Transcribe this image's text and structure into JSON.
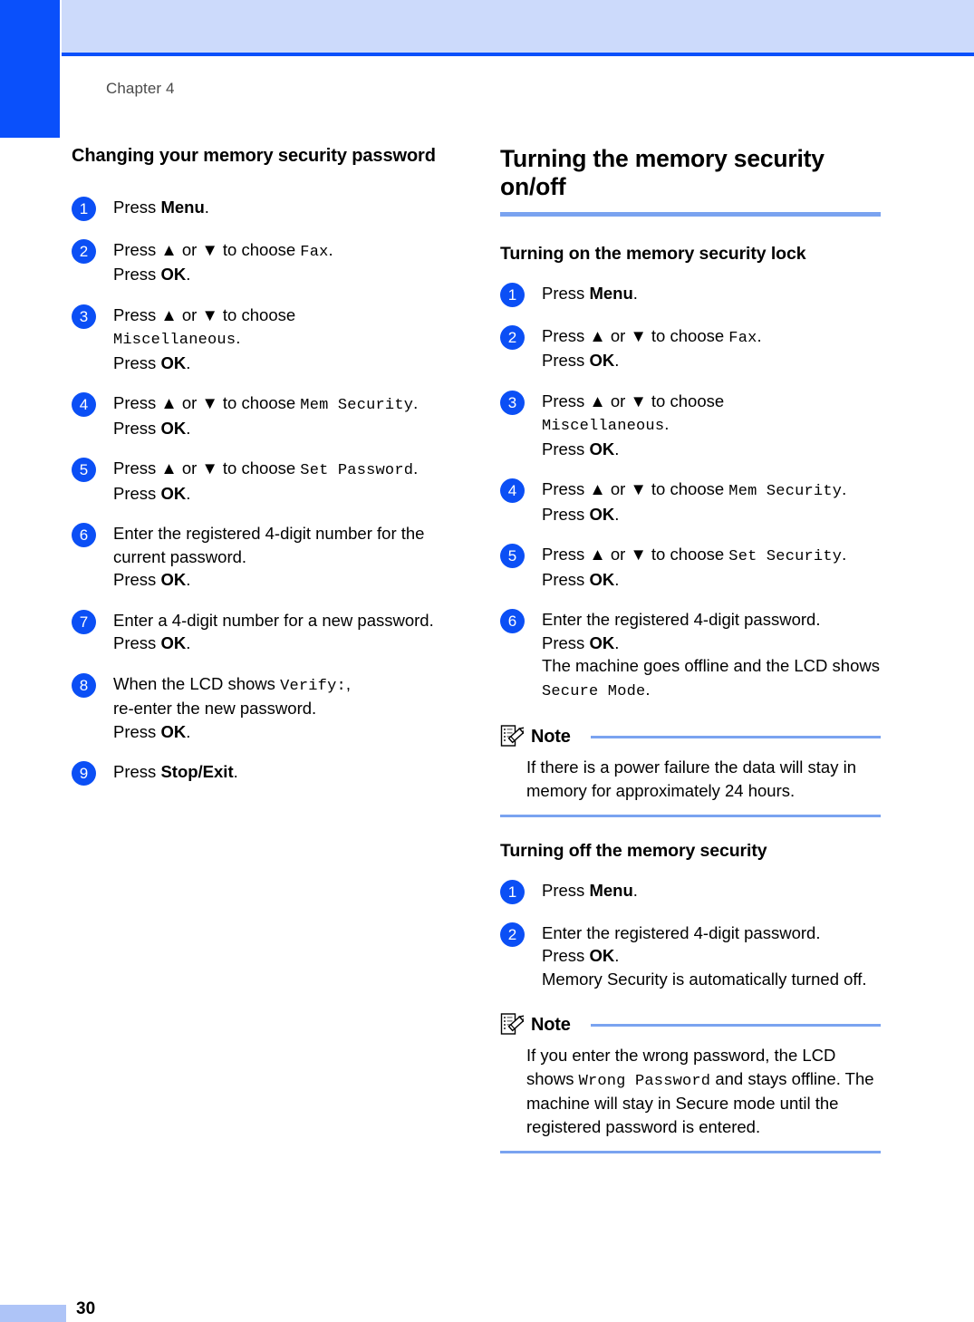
{
  "page": {
    "chapter_label": "Chapter 4",
    "page_number": "30",
    "accent_dark_blue": "#0a50fb",
    "accent_light_blue": "#ccdafb",
    "accent_rule_blue": "#7aa3f0",
    "badge_blue": "#0b4ff5"
  },
  "left_column": {
    "heading": "Changing your memory security password",
    "steps": [
      {
        "number": "1",
        "lines": [
          [
            {
              "t": "Press ",
              "s": "normal"
            },
            {
              "t": "Menu",
              "s": "bold"
            },
            {
              "t": ".",
              "s": "normal"
            }
          ]
        ]
      },
      {
        "number": "2",
        "lines": [
          [
            {
              "t": "Press ▲ or ▼ to choose ",
              "s": "normal"
            },
            {
              "t": "Fax",
              "s": "lcd"
            },
            {
              "t": ".",
              "s": "normal"
            }
          ],
          [
            {
              "t": "Press ",
              "s": "normal"
            },
            {
              "t": "OK",
              "s": "bold"
            },
            {
              "t": ".",
              "s": "normal"
            }
          ]
        ]
      },
      {
        "number": "3",
        "lines": [
          [
            {
              "t": "Press ▲ or ▼ to choose",
              "s": "normal"
            }
          ],
          [
            {
              "t": "Miscellaneous",
              "s": "lcd"
            },
            {
              "t": ".",
              "s": "normal"
            }
          ],
          [
            {
              "t": "Press ",
              "s": "normal"
            },
            {
              "t": "OK",
              "s": "bold"
            },
            {
              "t": ".",
              "s": "normal"
            }
          ]
        ]
      },
      {
        "number": "4",
        "lines": [
          [
            {
              "t": "Press ▲ or ▼ to choose ",
              "s": "normal"
            },
            {
              "t": "Mem Security",
              "s": "lcd"
            },
            {
              "t": ".",
              "s": "normal"
            }
          ],
          [
            {
              "t": "Press ",
              "s": "normal"
            },
            {
              "t": "OK",
              "s": "bold"
            },
            {
              "t": ".",
              "s": "normal"
            }
          ]
        ]
      },
      {
        "number": "5",
        "lines": [
          [
            {
              "t": "Press ▲ or ▼ to choose ",
              "s": "normal"
            },
            {
              "t": "Set Password",
              "s": "lcd"
            },
            {
              "t": ".",
              "s": "normal"
            }
          ],
          [
            {
              "t": "Press ",
              "s": "normal"
            },
            {
              "t": "OK",
              "s": "bold"
            },
            {
              "t": ".",
              "s": "normal"
            }
          ]
        ]
      },
      {
        "number": "6",
        "lines": [
          [
            {
              "t": "Enter the registered 4-digit number for the current password.",
              "s": "normal"
            }
          ],
          [
            {
              "t": "Press ",
              "s": "normal"
            },
            {
              "t": "OK",
              "s": "bold"
            },
            {
              "t": ".",
              "s": "normal"
            }
          ]
        ]
      },
      {
        "number": "7",
        "lines": [
          [
            {
              "t": "Enter a 4-digit number for a new password.",
              "s": "normal"
            }
          ],
          [
            {
              "t": "Press ",
              "s": "normal"
            },
            {
              "t": "OK",
              "s": "bold"
            },
            {
              "t": ".",
              "s": "normal"
            }
          ]
        ]
      },
      {
        "number": "8",
        "lines": [
          [
            {
              "t": "When the LCD shows ",
              "s": "normal"
            },
            {
              "t": "Verify:",
              "s": "lcd"
            },
            {
              "t": ",",
              "s": "normal"
            }
          ],
          [
            {
              "t": "re-enter the new password.",
              "s": "normal"
            }
          ],
          [
            {
              "t": "Press ",
              "s": "normal"
            },
            {
              "t": "OK",
              "s": "bold"
            },
            {
              "t": ".",
              "s": "normal"
            }
          ]
        ]
      },
      {
        "number": "9",
        "lines": [
          [
            {
              "t": "Press ",
              "s": "normal"
            },
            {
              "t": "Stop/Exit",
              "s": "bold"
            },
            {
              "t": ".",
              "s": "normal"
            }
          ]
        ]
      }
    ]
  },
  "right_column": {
    "section_heading": "Turning the memory security on/off",
    "subsection_on": {
      "heading": "Turning on the memory security lock",
      "steps": [
        {
          "number": "1",
          "lines": [
            [
              {
                "t": "Press ",
                "s": "normal"
              },
              {
                "t": "Menu",
                "s": "bold"
              },
              {
                "t": ".",
                "s": "normal"
              }
            ]
          ]
        },
        {
          "number": "2",
          "lines": [
            [
              {
                "t": "Press ▲ or ▼ to choose ",
                "s": "normal"
              },
              {
                "t": "Fax",
                "s": "lcd"
              },
              {
                "t": ".",
                "s": "normal"
              }
            ],
            [
              {
                "t": "Press ",
                "s": "normal"
              },
              {
                "t": "OK",
                "s": "bold"
              },
              {
                "t": ".",
                "s": "normal"
              }
            ]
          ]
        },
        {
          "number": "3",
          "lines": [
            [
              {
                "t": "Press ▲ or ▼ to choose",
                "s": "normal"
              }
            ],
            [
              {
                "t": "Miscellaneous",
                "s": "lcd"
              },
              {
                "t": ".",
                "s": "normal"
              }
            ],
            [
              {
                "t": "Press ",
                "s": "normal"
              },
              {
                "t": "OK",
                "s": "bold"
              },
              {
                "t": ".",
                "s": "normal"
              }
            ]
          ]
        },
        {
          "number": "4",
          "lines": [
            [
              {
                "t": "Press ▲ or ▼ to choose ",
                "s": "normal"
              },
              {
                "t": "Mem Security",
                "s": "lcd"
              },
              {
                "t": ".",
                "s": "normal"
              }
            ],
            [
              {
                "t": "Press ",
                "s": "normal"
              },
              {
                "t": "OK",
                "s": "bold"
              },
              {
                "t": ".",
                "s": "normal"
              }
            ]
          ]
        },
        {
          "number": "5",
          "lines": [
            [
              {
                "t": "Press ▲ or ▼ to choose ",
                "s": "normal"
              },
              {
                "t": "Set Security",
                "s": "lcd"
              },
              {
                "t": ".",
                "s": "normal"
              }
            ],
            [
              {
                "t": "Press ",
                "s": "normal"
              },
              {
                "t": "OK",
                "s": "bold"
              },
              {
                "t": ".",
                "s": "normal"
              }
            ]
          ]
        },
        {
          "number": "6",
          "lines": [
            [
              {
                "t": "Enter the registered 4-digit password.",
                "s": "normal"
              }
            ],
            [
              {
                "t": "Press ",
                "s": "normal"
              },
              {
                "t": "OK",
                "s": "bold"
              },
              {
                "t": ".",
                "s": "normal"
              }
            ],
            [
              {
                "t": "The machine goes offline and the LCD shows ",
                "s": "normal"
              },
              {
                "t": "Secure Mode",
                "s": "lcd"
              },
              {
                "t": ".",
                "s": "normal"
              }
            ]
          ]
        }
      ],
      "note": {
        "label": "Note",
        "icon": "note-pencil-icon",
        "text": "If there is a power failure the data will stay in memory for approximately 24 hours."
      }
    },
    "subsection_off": {
      "heading": "Turning off the memory security",
      "steps": [
        {
          "number": "1",
          "lines": [
            [
              {
                "t": "Press ",
                "s": "normal"
              },
              {
                "t": "Menu",
                "s": "bold"
              },
              {
                "t": ".",
                "s": "normal"
              }
            ]
          ]
        },
        {
          "number": "2",
          "lines": [
            [
              {
                "t": "Enter the registered 4-digit password.",
                "s": "normal"
              }
            ],
            [
              {
                "t": "Press ",
                "s": "normal"
              },
              {
                "t": "OK",
                "s": "bold"
              },
              {
                "t": ".",
                "s": "normal"
              }
            ],
            [
              {
                "t": "Memory Security is automatically turned off.",
                "s": "normal"
              }
            ]
          ]
        }
      ],
      "note": {
        "label": "Note",
        "icon": "note-pencil-icon",
        "text_parts": [
          {
            "t": "If you enter the wrong password, the LCD shows ",
            "s": "normal"
          },
          {
            "t": "Wrong Password",
            "s": "lcd"
          },
          {
            "t": " and stays offline. The machine will stay in Secure mode until the registered password is entered.",
            "s": "normal"
          }
        ]
      }
    }
  }
}
